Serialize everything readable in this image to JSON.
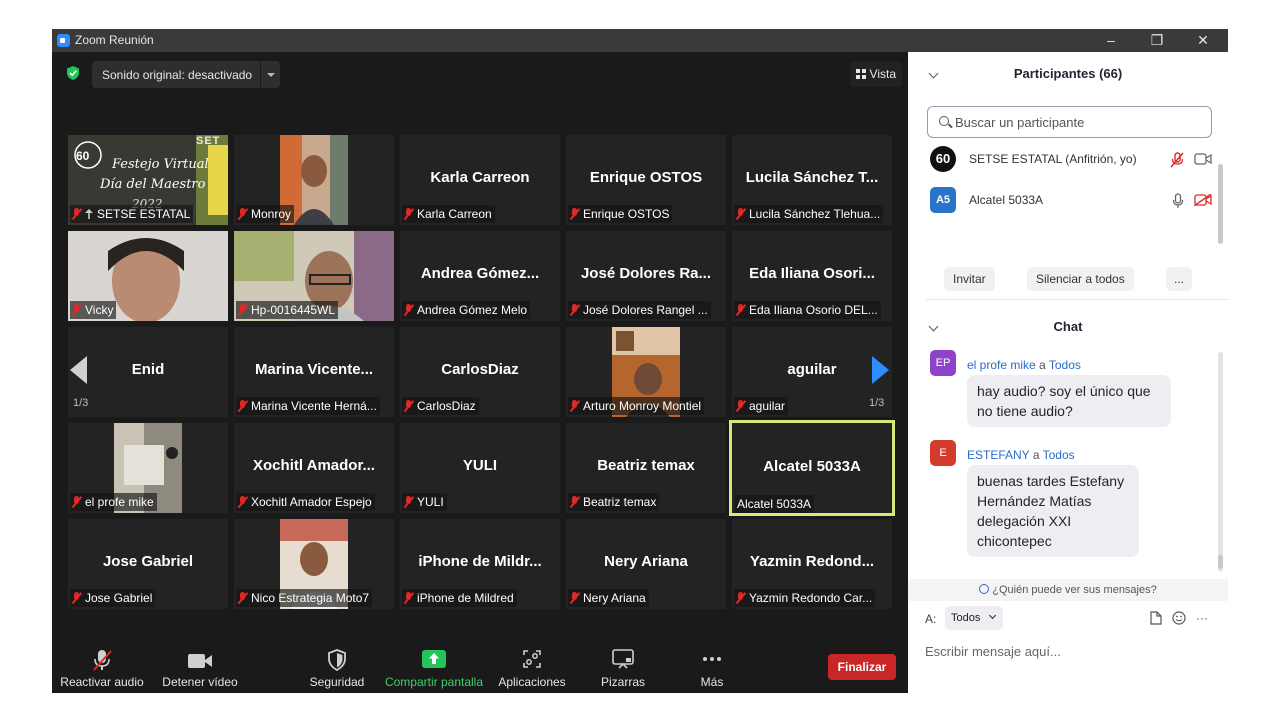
{
  "window": {
    "title": "Zoom Reunión",
    "controls": [
      "–",
      "❐",
      "✕"
    ]
  },
  "topbar": {
    "audio_label": "Sonido original: desactivado",
    "view_label": "Vista"
  },
  "tiles": [
    {
      "label": "SETSE ESTATAL"
    },
    {
      "label": "Monroy"
    },
    {
      "name": "Karla Carreon",
      "label": "Karla Carreon"
    },
    {
      "name": "Enrique OSTOS",
      "label": "Enrique OSTOS"
    },
    {
      "name": "Lucila Sánchez T...",
      "label": "Lucila Sánchez Tlehua..."
    },
    {
      "label": "Vicky"
    },
    {
      "label": "Hp-0016445WL"
    },
    {
      "name": "Andrea Gómez...",
      "label": "Andrea Gómez Melo"
    },
    {
      "name": "José Dolores Ra...",
      "label": "José Dolores Rangel ..."
    },
    {
      "name": "Eda Iliana Osori...",
      "label": "Eda Iliana Osorio DEL..."
    },
    {
      "name": "Enid",
      "label": ""
    },
    {
      "name": "Marina Vicente...",
      "label": "Marina Vicente Herná..."
    },
    {
      "name": "CarlosDiaz",
      "label": "CarlosDiaz"
    },
    {
      "label": "Arturo Monroy Montiel"
    },
    {
      "name": "aguilar",
      "label": "aguilar"
    },
    {
      "label": "el profe mike"
    },
    {
      "name": "Xochitl Amador...",
      "label": "Xochitl Amador Espejo"
    },
    {
      "name": "YULI",
      "label": "YULI"
    },
    {
      "name": "Beatriz temax",
      "label": "Beatriz temax"
    },
    {
      "name": "Alcatel 5033A",
      "label": "Alcatel 5033A"
    },
    {
      "name": "Jose Gabriel",
      "label": "Jose Gabriel"
    },
    {
      "label": "Nico Estrategia Moto7"
    },
    {
      "name": "iPhone de Mildr...",
      "label": "iPhone de Mildred"
    },
    {
      "name": "Nery Ariana",
      "label": "Nery Ariana"
    },
    {
      "name": "Yazmin Redond...",
      "label": "Yazmin Redondo Car..."
    }
  ],
  "setse_banner": {
    "number": "60",
    "line1": "Festejo Virtual",
    "line2": "Día del Maestro",
    "year": "2022",
    "corner": "SET"
  },
  "pagination": {
    "left": "1/3",
    "right": "1/3"
  },
  "toolbar": {
    "audio": "Reactivar audio",
    "video": "Detener vídeo",
    "security": "Seguridad",
    "share": "Compartir pantalla",
    "apps": "Aplicaciones",
    "whiteboards": "Pizarras",
    "more": "Más",
    "end": "Finalizar"
  },
  "participants": {
    "title": "Participantes (66)",
    "search_placeholder": "Buscar un participante",
    "list": [
      {
        "name": "SETSE ESTATAL (Anfitrión, yo)",
        "avatar": "60"
      },
      {
        "name": "Alcatel 5033A",
        "avatar": "A5"
      }
    ],
    "invite": "Invitar",
    "mute_all": "Silenciar a todos",
    "more": "..."
  },
  "chat": {
    "title": "Chat",
    "messages": [
      {
        "avatar": "EP",
        "sender": "el profe mike",
        "to_word": "a",
        "to": "Todos",
        "text": "hay audio? soy el único que no tiene audio?",
        "avatar_color": "#8e44c8"
      },
      {
        "avatar": "E",
        "sender": "ESTEFANY",
        "to_word": "a",
        "to": "Todos",
        "text": "buenas tardes Estefany Hernández Matías delegación XXI chicontepec",
        "avatar_color": "#d23c2c"
      }
    ],
    "who_can_see": "¿Quién puede ver sus mensajes?",
    "to_label": "A:",
    "recipient": "Todos",
    "input_placeholder": "Escribir mensaje aquí...",
    "more": "···"
  }
}
